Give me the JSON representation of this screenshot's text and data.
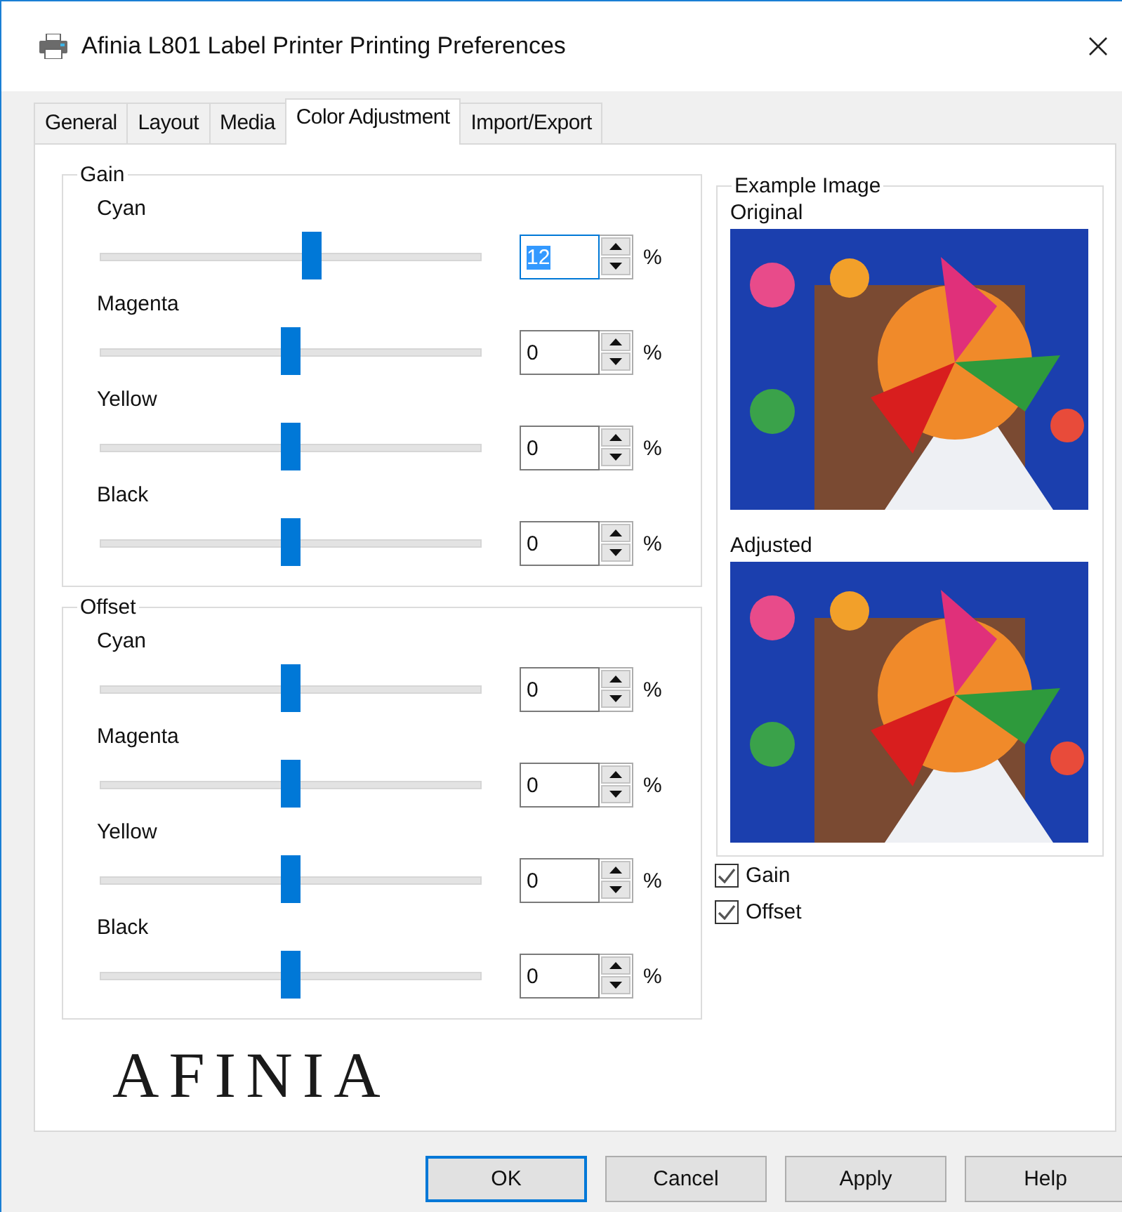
{
  "window": {
    "title": "Afinia L801 Label Printer Printing Preferences"
  },
  "tabs": [
    {
      "label": "General",
      "selected": false
    },
    {
      "label": "Layout",
      "selected": false
    },
    {
      "label": "Media",
      "selected": false
    },
    {
      "label": "Color Adjustment",
      "selected": true
    },
    {
      "label": "Import/Export",
      "selected": false
    }
  ],
  "groups": [
    {
      "title": "Gain",
      "rows": [
        {
          "label": "Cyan",
          "level": 0.556,
          "value": "12",
          "unit": "%",
          "highlighted": true
        },
        {
          "label": "Magenta",
          "level": 0.5,
          "value": "0",
          "unit": "%",
          "highlighted": false
        },
        {
          "label": "Yellow",
          "level": 0.5,
          "value": "0",
          "unit": "%",
          "highlighted": false
        },
        {
          "label": "Black",
          "level": 0.5,
          "value": "0",
          "unit": "%",
          "highlighted": false
        }
      ]
    },
    {
      "title": "Offset",
      "rows": [
        {
          "label": "Cyan",
          "level": 0.5,
          "value": "0",
          "unit": "%",
          "highlighted": false
        },
        {
          "label": "Magenta",
          "level": 0.5,
          "value": "0",
          "unit": "%",
          "highlighted": false
        },
        {
          "label": "Yellow",
          "level": 0.5,
          "value": "0",
          "unit": "%",
          "highlighted": false
        },
        {
          "label": "Black",
          "level": 0.5,
          "value": "0",
          "unit": "%",
          "highlighted": false
        }
      ]
    }
  ],
  "example": {
    "title": "Example Image",
    "images": [
      {
        "label": "Original"
      },
      {
        "label": "Adjusted"
      }
    ]
  },
  "checkboxes": [
    {
      "label": "Gain",
      "checked": true
    },
    {
      "label": "Offset",
      "checked": true
    }
  ],
  "logo": {
    "text": "AFINIA"
  },
  "buttons": [
    {
      "label": "OK",
      "default": true
    },
    {
      "label": "Cancel",
      "default": false
    },
    {
      "label": "Apply",
      "default": false
    },
    {
      "label": "Help",
      "default": false
    }
  ]
}
